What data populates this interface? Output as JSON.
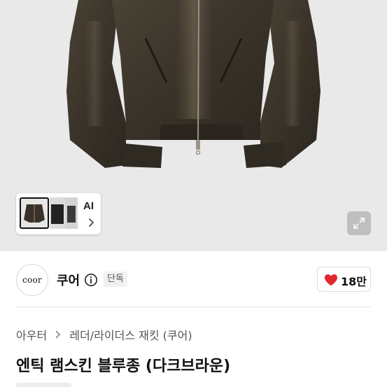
{
  "gallery": {
    "ai_label": "AI"
  },
  "brand": {
    "logo_text": "coor",
    "name": "쿠어",
    "exclusive_badge": "단독",
    "likes": "18만",
    "like_color": "#e0282e"
  },
  "breadcrumb": {
    "items": [
      "아우터",
      "레더/라이더스 재킷 (쿠어)"
    ]
  },
  "product": {
    "title": "엔틱 램스킨 블루종 (다크브라운)"
  },
  "icons": {
    "ai_more": "chevron-right-icon",
    "expand": "expand-icon",
    "info": "info-icon",
    "like": "heart-icon",
    "breadcrumb_sep": "chevron-right-icon"
  }
}
